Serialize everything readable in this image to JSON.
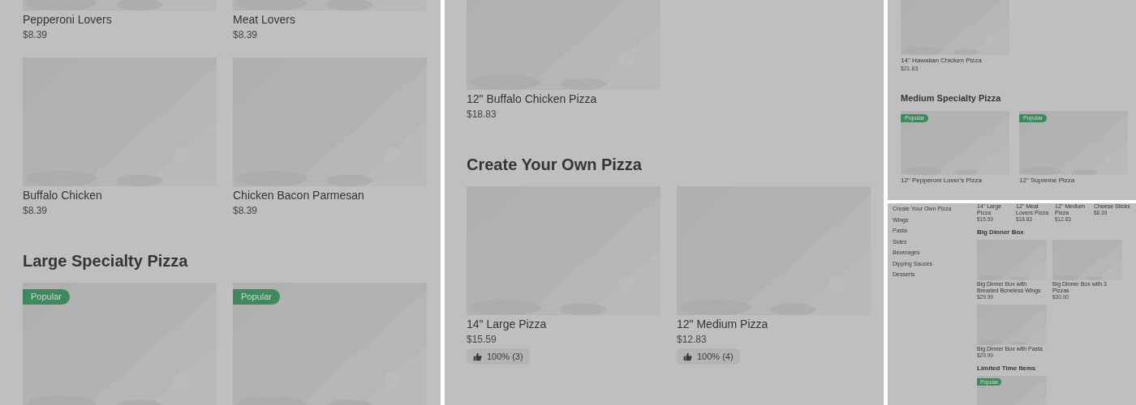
{
  "panels": [
    {
      "kind": "large",
      "sections": [
        {
          "kind": "cards",
          "items": [
            {
              "name": "Pepperoni Lovers",
              "price": "$8.39"
            },
            {
              "name": "Meat Lovers",
              "price": "$8.39"
            },
            {
              "name": "Buffalo Chicken",
              "price": "$8.39"
            },
            {
              "name": "Chicken Bacon Parmesan",
              "price": "$8.39"
            }
          ]
        },
        {
          "kind": "cards",
          "heading": "Large Specialty Pizza",
          "items": [
            {
              "badge": "Popular"
            },
            {
              "badge": "Popular"
            }
          ]
        }
      ]
    },
    {
      "kind": "large",
      "sections": [
        {
          "kind": "cards",
          "items": [
            {
              "name": "12\" Buffalo Chicken Pizza",
              "price": "$18.83"
            }
          ]
        },
        {
          "kind": "cards",
          "heading": "Create Your Own Pizza",
          "items": [
            {
              "name": "14\" Large Pizza",
              "price": "$15.59",
              "rating": "100% (3)"
            },
            {
              "name": "12\" Medium Pizza",
              "price": "$12.83",
              "rating": "100% (4)"
            }
          ]
        }
      ]
    },
    {
      "kind": "small",
      "sections": [
        {
          "kind": "cards",
          "items": [
            {
              "name": "14\" Hawaiian Chicken Pizza",
              "price": "$21.83"
            }
          ]
        },
        {
          "kind": "cards",
          "heading": "Medium Specialty Pizza",
          "items": [
            {
              "name": "12\" Pepperoni Lover's Pizza",
              "badge": "Popular"
            },
            {
              "name": "12\" Supreme Pizza",
              "badge": "Popular"
            }
          ]
        }
      ]
    },
    {
      "kind": "tiny",
      "sidebar": [
        "Create Your Own Pizza",
        "Wings",
        "Pasta",
        "Sides",
        "Beverages",
        "Dipping Sauces",
        "Desserts"
      ],
      "sections": [
        {
          "kind": "text_row",
          "items": [
            {
              "name": "14\" Large Pizza",
              "price": "$15.59"
            },
            {
              "name": "12\" Meat Lovers Pizza",
              "price": "$18.83"
            },
            {
              "name": "12\" Medium Pizza",
              "price": "$12.83"
            },
            {
              "name": "Cheese Sticks",
              "price": "$8.39"
            }
          ]
        },
        {
          "kind": "cards",
          "heading": "Big Dinner Box",
          "items": [
            {
              "name": "Big Dinner Box with Breaded Boneless Wings",
              "price": "$29.99"
            },
            {
              "name": "Big Dinner Box with 3 Pizzas",
              "price": "$30.00"
            },
            {
              "name": "Big Dinner Box with Pasta",
              "price": "$29.99"
            }
          ]
        },
        {
          "kind": "cards",
          "heading": "Limited Time Items",
          "items": [
            {
              "badge": "Popular"
            }
          ]
        }
      ]
    }
  ]
}
